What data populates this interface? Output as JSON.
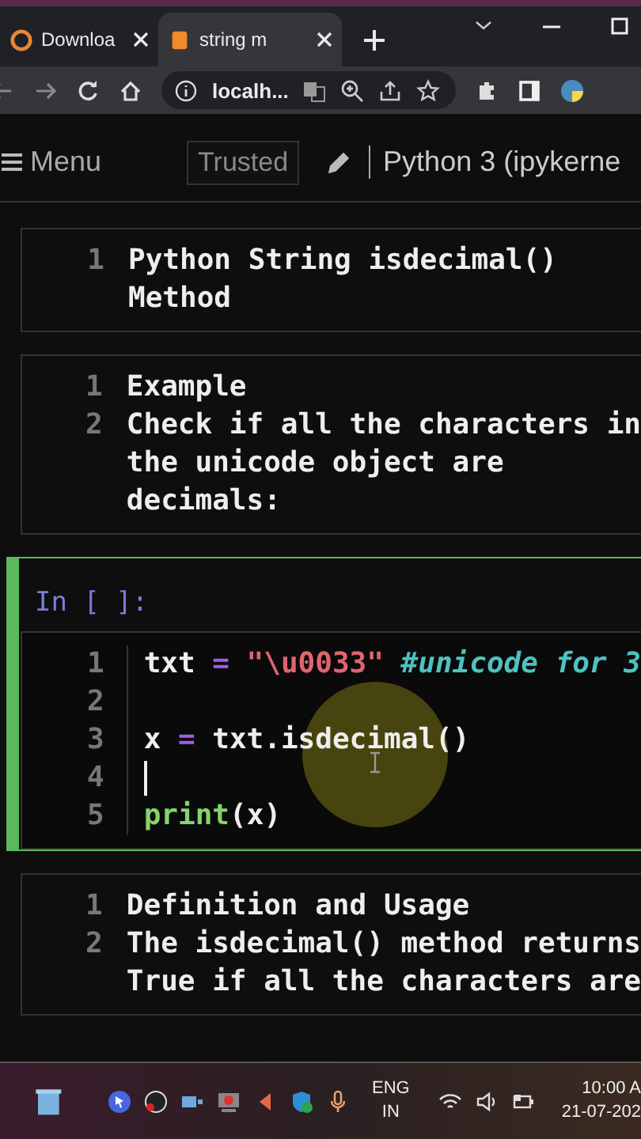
{
  "browser": {
    "tabs": [
      {
        "title": "Downloa",
        "selected": false
      },
      {
        "title": "string m",
        "selected": true
      }
    ],
    "address": "localh..."
  },
  "notebook_header": {
    "menu": "Menu",
    "trusted": "Trusted",
    "kernel": "Python 3 (ipykerne"
  },
  "cells": [
    {
      "kind": "markdown",
      "selected": false,
      "lines": [
        "Python String isdecimal()",
        "Method"
      ],
      "numbers": [
        "1"
      ]
    },
    {
      "kind": "markdown",
      "selected": false,
      "lines": [
        "Example",
        "Check if all the characters in",
        "the unicode object are",
        "decimals:"
      ],
      "numbers": [
        "1",
        "2"
      ]
    },
    {
      "kind": "code",
      "selected": true,
      "prompt": "In [ ]:",
      "numbers": [
        "1",
        "2",
        "3",
        "4",
        "5"
      ],
      "code": [
        {
          "cursor": false,
          "tokens": [
            {
              "text": "txt",
              "kind": "name"
            },
            {
              "text": "=",
              "kind": "op"
            },
            {
              "text": "\"\\u0033\"",
              "kind": "string"
            },
            {
              "text": "#unicode for 3",
              "kind": "comment"
            }
          ]
        },
        {
          "cursor": false
        },
        {
          "cursor": false,
          "tokens": [
            {
              "text": "x",
              "kind": "name"
            },
            {
              "text": "=",
              "kind": "op"
            },
            {
              "text": "txt.isdecimal()",
              "kind": "name"
            }
          ]
        },
        {
          "cursor": true
        },
        {
          "cursor": false,
          "tokens": [
            {
              "text": "print",
              "kind": "builtin"
            },
            {
              "text": "(x)",
              "kind": "name",
              "joined": true
            }
          ]
        }
      ]
    },
    {
      "kind": "markdown",
      "selected": false,
      "lines": [
        "Definition and Usage",
        "The isdecimal() method returns",
        "True if all the characters are"
      ],
      "numbers": [
        "1",
        "2"
      ]
    }
  ],
  "taskbar": {
    "language": [
      "ENG",
      "IN"
    ],
    "time": "10:00 A",
    "date": "21-07-202"
  }
}
